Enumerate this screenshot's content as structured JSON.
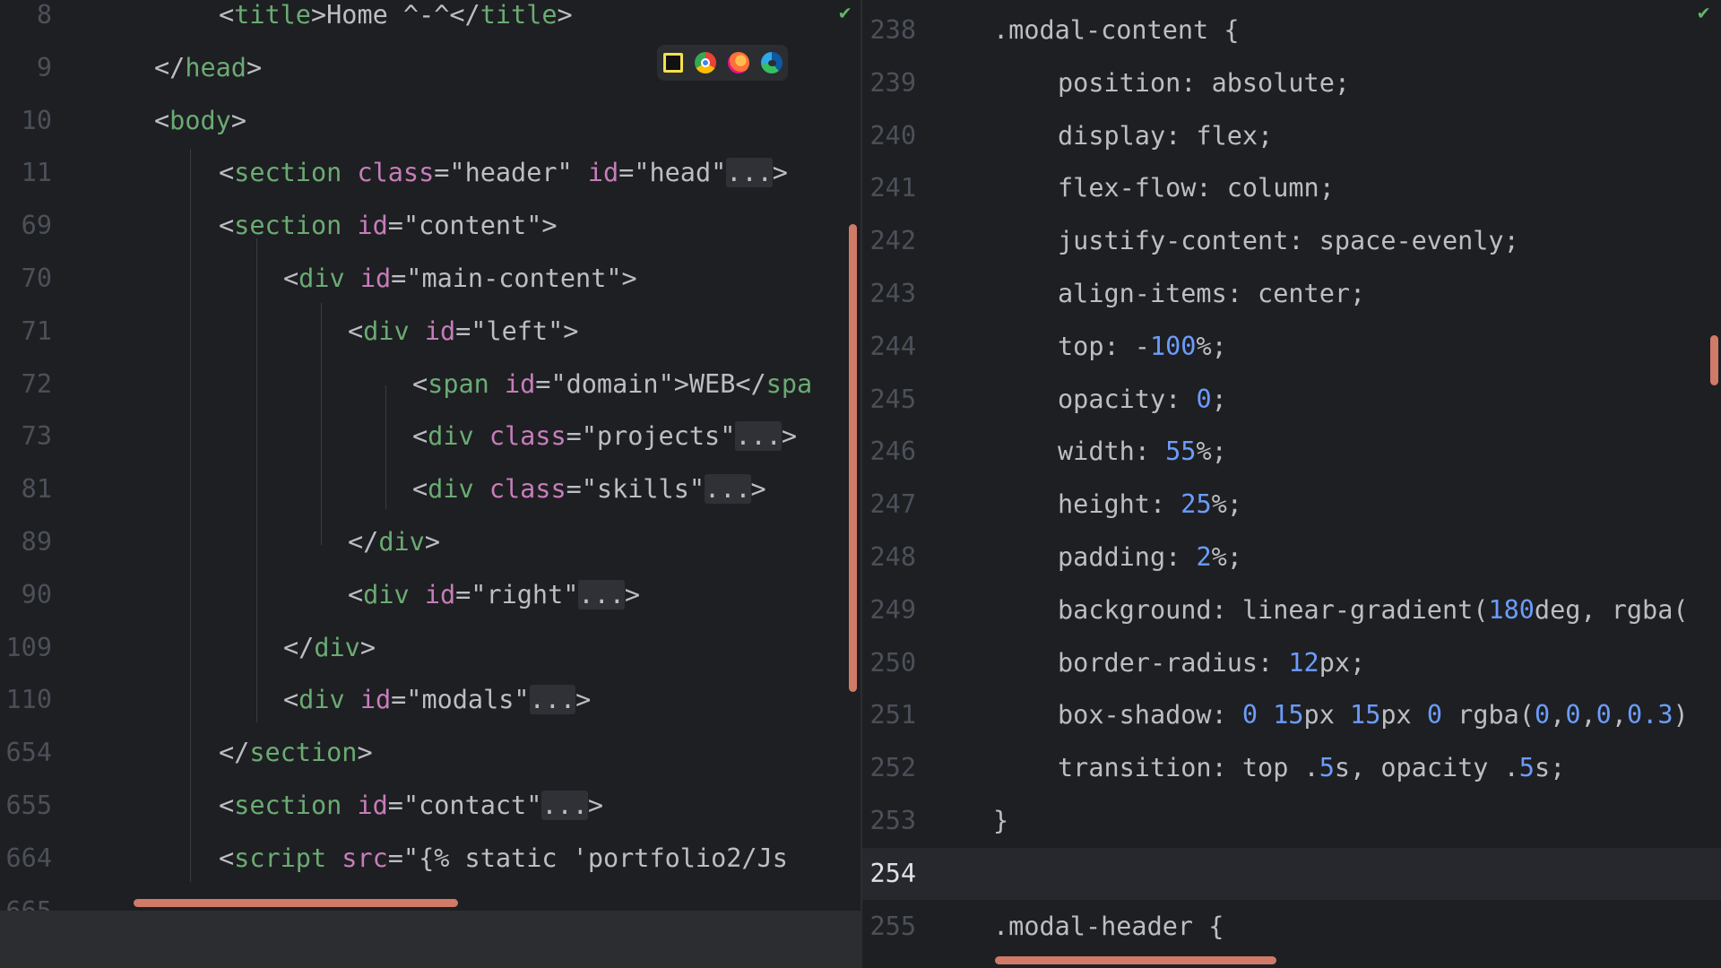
{
  "left_editor": {
    "lines": [
      {
        "num": "8",
        "parts": [
          [
            "t-punc",
            "<"
          ],
          [
            "t-name",
            "title"
          ],
          [
            "t-punc",
            ">Home ^-^</"
          ],
          [
            "t-name",
            "title"
          ],
          [
            "t-punc",
            ">"
          ]
        ],
        "indent": 2
      },
      {
        "num": "9",
        "parts": [
          [
            "t-punc",
            "</"
          ],
          [
            "t-name",
            "head"
          ],
          [
            "t-punc",
            ">"
          ]
        ],
        "indent": 1
      },
      {
        "num": "10",
        "parts": [
          [
            "t-punc",
            "<"
          ],
          [
            "t-name",
            "body"
          ],
          [
            "t-punc",
            ">"
          ]
        ],
        "indent": 1
      },
      {
        "num": "11",
        "parts": [
          [
            "t-punc",
            "<"
          ],
          [
            "t-name",
            "section "
          ],
          [
            "t-attr",
            "class"
          ],
          [
            "t-str",
            "=\"header\" "
          ],
          [
            "t-attr",
            "id"
          ],
          [
            "t-str",
            "=\"head\""
          ],
          [
            "fold",
            "..."
          ],
          [
            "t-punc",
            ">"
          ]
        ],
        "indent": 2
      },
      {
        "num": "69",
        "parts": [
          [
            "t-punc",
            "<"
          ],
          [
            "t-name",
            "section "
          ],
          [
            "t-attr",
            "id"
          ],
          [
            "t-str",
            "=\"content\">"
          ]
        ],
        "indent": 2
      },
      {
        "num": "70",
        "parts": [
          [
            "t-punc",
            "<"
          ],
          [
            "t-name",
            "div "
          ],
          [
            "t-attr",
            "id"
          ],
          [
            "t-str",
            "=\"main-content\">"
          ]
        ],
        "indent": 3
      },
      {
        "num": "71",
        "parts": [
          [
            "t-punc",
            "<"
          ],
          [
            "t-name",
            "div "
          ],
          [
            "t-attr",
            "id"
          ],
          [
            "t-str",
            "=\"left\">"
          ]
        ],
        "indent": 4
      },
      {
        "num": "72",
        "parts": [
          [
            "t-punc",
            "<"
          ],
          [
            "t-name",
            "span "
          ],
          [
            "t-attr",
            "id"
          ],
          [
            "t-str",
            "=\"domain\">WEB</"
          ],
          [
            "t-name",
            "spa"
          ]
        ],
        "indent": 5
      },
      {
        "num": "73",
        "parts": [
          [
            "t-punc",
            "<"
          ],
          [
            "t-name",
            "div "
          ],
          [
            "t-attr",
            "class"
          ],
          [
            "t-str",
            "=\"projects\""
          ],
          [
            "fold",
            "..."
          ],
          [
            "t-punc",
            ">"
          ]
        ],
        "indent": 5
      },
      {
        "num": "81",
        "parts": [
          [
            "t-punc",
            "<"
          ],
          [
            "t-name",
            "div "
          ],
          [
            "t-attr",
            "class"
          ],
          [
            "t-str",
            "=\"skills\""
          ],
          [
            "fold",
            "..."
          ],
          [
            "t-punc",
            ">"
          ]
        ],
        "indent": 5
      },
      {
        "num": "89",
        "parts": [
          [
            "t-punc",
            "</"
          ],
          [
            "t-name",
            "div"
          ],
          [
            "t-punc",
            ">"
          ]
        ],
        "indent": 4
      },
      {
        "num": "90",
        "parts": [
          [
            "t-punc",
            "<"
          ],
          [
            "t-name",
            "div "
          ],
          [
            "t-attr",
            "id"
          ],
          [
            "t-str",
            "=\"right\""
          ],
          [
            "fold",
            "..."
          ],
          [
            "t-punc",
            ">"
          ]
        ],
        "indent": 4
      },
      {
        "num": "109",
        "parts": [
          [
            "t-punc",
            "</"
          ],
          [
            "t-name",
            "div"
          ],
          [
            "t-punc",
            ">"
          ]
        ],
        "indent": 3
      },
      {
        "num": "110",
        "parts": [
          [
            "t-punc",
            "<"
          ],
          [
            "t-name",
            "div "
          ],
          [
            "t-attr",
            "id"
          ],
          [
            "t-str",
            "=\"modals\""
          ],
          [
            "fold",
            "..."
          ],
          [
            "t-punc",
            ">"
          ]
        ],
        "indent": 3
      },
      {
        "num": "654",
        "parts": [
          [
            "t-punc",
            "</"
          ],
          [
            "t-name",
            "section"
          ],
          [
            "t-punc",
            ">"
          ]
        ],
        "indent": 2
      },
      {
        "num": "655",
        "parts": [
          [
            "t-punc",
            "<"
          ],
          [
            "t-name",
            "section "
          ],
          [
            "t-attr",
            "id"
          ],
          [
            "t-str",
            "=\"contact\""
          ],
          [
            "fold",
            "..."
          ],
          [
            "t-punc",
            ">"
          ]
        ],
        "indent": 2
      },
      {
        "num": "664",
        "parts": [
          [
            "t-punc",
            "<"
          ],
          [
            "t-name",
            "script "
          ],
          [
            "t-attr",
            "src"
          ],
          [
            "t-str",
            "=\"{% static 'portfolio2/Js"
          ]
        ],
        "indent": 2
      },
      {
        "num": "665",
        "parts": [],
        "indent": 0
      }
    ]
  },
  "right_editor": {
    "lines": [
      {
        "num": "238",
        "parts": [
          [
            "t-punc",
            ".modal-content {"
          ]
        ],
        "indent": 0
      },
      {
        "num": "239",
        "parts": [
          [
            "t-punc",
            "position: absolute;"
          ]
        ],
        "indent": 1
      },
      {
        "num": "240",
        "parts": [
          [
            "t-punc",
            "display: flex;"
          ]
        ],
        "indent": 1
      },
      {
        "num": "241",
        "parts": [
          [
            "t-punc",
            "flex-flow: column;"
          ]
        ],
        "indent": 1
      },
      {
        "num": "242",
        "parts": [
          [
            "t-punc",
            "justify-content: space-evenly;"
          ]
        ],
        "indent": 1
      },
      {
        "num": "243",
        "parts": [
          [
            "t-punc",
            "align-items: center;"
          ]
        ],
        "indent": 1
      },
      {
        "num": "244",
        "parts": [
          [
            "t-punc",
            "top: -"
          ],
          [
            "t-num",
            "100"
          ],
          [
            "t-punc",
            "%;"
          ]
        ],
        "indent": 1
      },
      {
        "num": "245",
        "parts": [
          [
            "t-punc",
            "opacity: "
          ],
          [
            "t-num",
            "0"
          ],
          [
            "t-punc",
            ";"
          ]
        ],
        "indent": 1
      },
      {
        "num": "246",
        "parts": [
          [
            "t-punc",
            "width: "
          ],
          [
            "t-num",
            "55"
          ],
          [
            "t-punc",
            "%;"
          ]
        ],
        "indent": 1
      },
      {
        "num": "247",
        "parts": [
          [
            "t-punc",
            "height: "
          ],
          [
            "t-num",
            "25"
          ],
          [
            "t-punc",
            "%;"
          ]
        ],
        "indent": 1
      },
      {
        "num": "248",
        "parts": [
          [
            "t-punc",
            "padding: "
          ],
          [
            "t-num",
            "2"
          ],
          [
            "t-punc",
            "%;"
          ]
        ],
        "indent": 1
      },
      {
        "num": "249",
        "parts": [
          [
            "t-punc",
            "background: linear-gradient("
          ],
          [
            "t-num",
            "180"
          ],
          [
            "t-punc",
            "deg, rgba("
          ]
        ],
        "indent": 1
      },
      {
        "num": "250",
        "parts": [
          [
            "t-punc",
            "border-radius: "
          ],
          [
            "t-num",
            "12"
          ],
          [
            "t-punc",
            "px;"
          ]
        ],
        "indent": 1
      },
      {
        "num": "251",
        "parts": [
          [
            "t-punc",
            "box-shadow: "
          ],
          [
            "t-num",
            "0 15"
          ],
          [
            "t-punc",
            "px "
          ],
          [
            "t-num",
            "15"
          ],
          [
            "t-punc",
            "px "
          ],
          [
            "t-num",
            "0"
          ],
          [
            "t-punc",
            " rgba("
          ],
          [
            "t-num",
            "0"
          ],
          [
            "t-punc",
            ","
          ],
          [
            "t-num",
            "0"
          ],
          [
            "t-punc",
            ","
          ],
          [
            "t-num",
            "0"
          ],
          [
            "t-punc",
            ","
          ],
          [
            "t-num",
            "0.3"
          ],
          [
            "t-punc",
            ")"
          ]
        ],
        "indent": 1
      },
      {
        "num": "252",
        "parts": [
          [
            "t-punc",
            "transition: top ."
          ],
          [
            "t-num",
            "5"
          ],
          [
            "t-punc",
            "s, opacity ."
          ],
          [
            "t-num",
            "5"
          ],
          [
            "t-punc",
            "s;"
          ]
        ],
        "indent": 1
      },
      {
        "num": "253",
        "parts": [
          [
            "t-punc",
            "}"
          ]
        ],
        "indent": 0
      },
      {
        "num": "254",
        "parts": [],
        "indent": 0,
        "current": true
      },
      {
        "num": "255",
        "parts": [
          [
            "t-punc",
            ".modal-header {"
          ]
        ],
        "indent": 0
      }
    ]
  },
  "browser_icons": [
    "intellij-icon",
    "chrome-icon",
    "firefox-icon",
    "edge-icon"
  ],
  "colors": {
    "tag": "#6aab73",
    "attr": "#c77dbb",
    "number": "#6c9cfc",
    "scrollbar": "#d07a68"
  }
}
